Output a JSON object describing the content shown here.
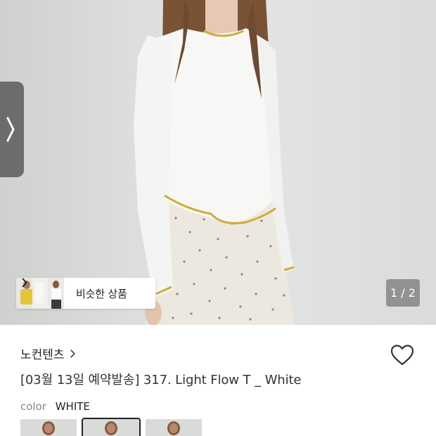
{
  "gallery": {
    "page_indicator": "1 / 2",
    "prev_icon": "chevron-right-icon",
    "similar_button_label": "비슷한 상품"
  },
  "product": {
    "brand": "노컨텐츠",
    "title": "[03월 13일 예약발송] 317. Light Flow T _ White",
    "color_key": "color",
    "color_value": "WHITE",
    "wishlist_icon": "heart-outline-icon"
  },
  "colors": {
    "accent_trim": "#d1ab3c",
    "indicator_bg": "#7a7a7a",
    "text_primary": "#222222"
  }
}
